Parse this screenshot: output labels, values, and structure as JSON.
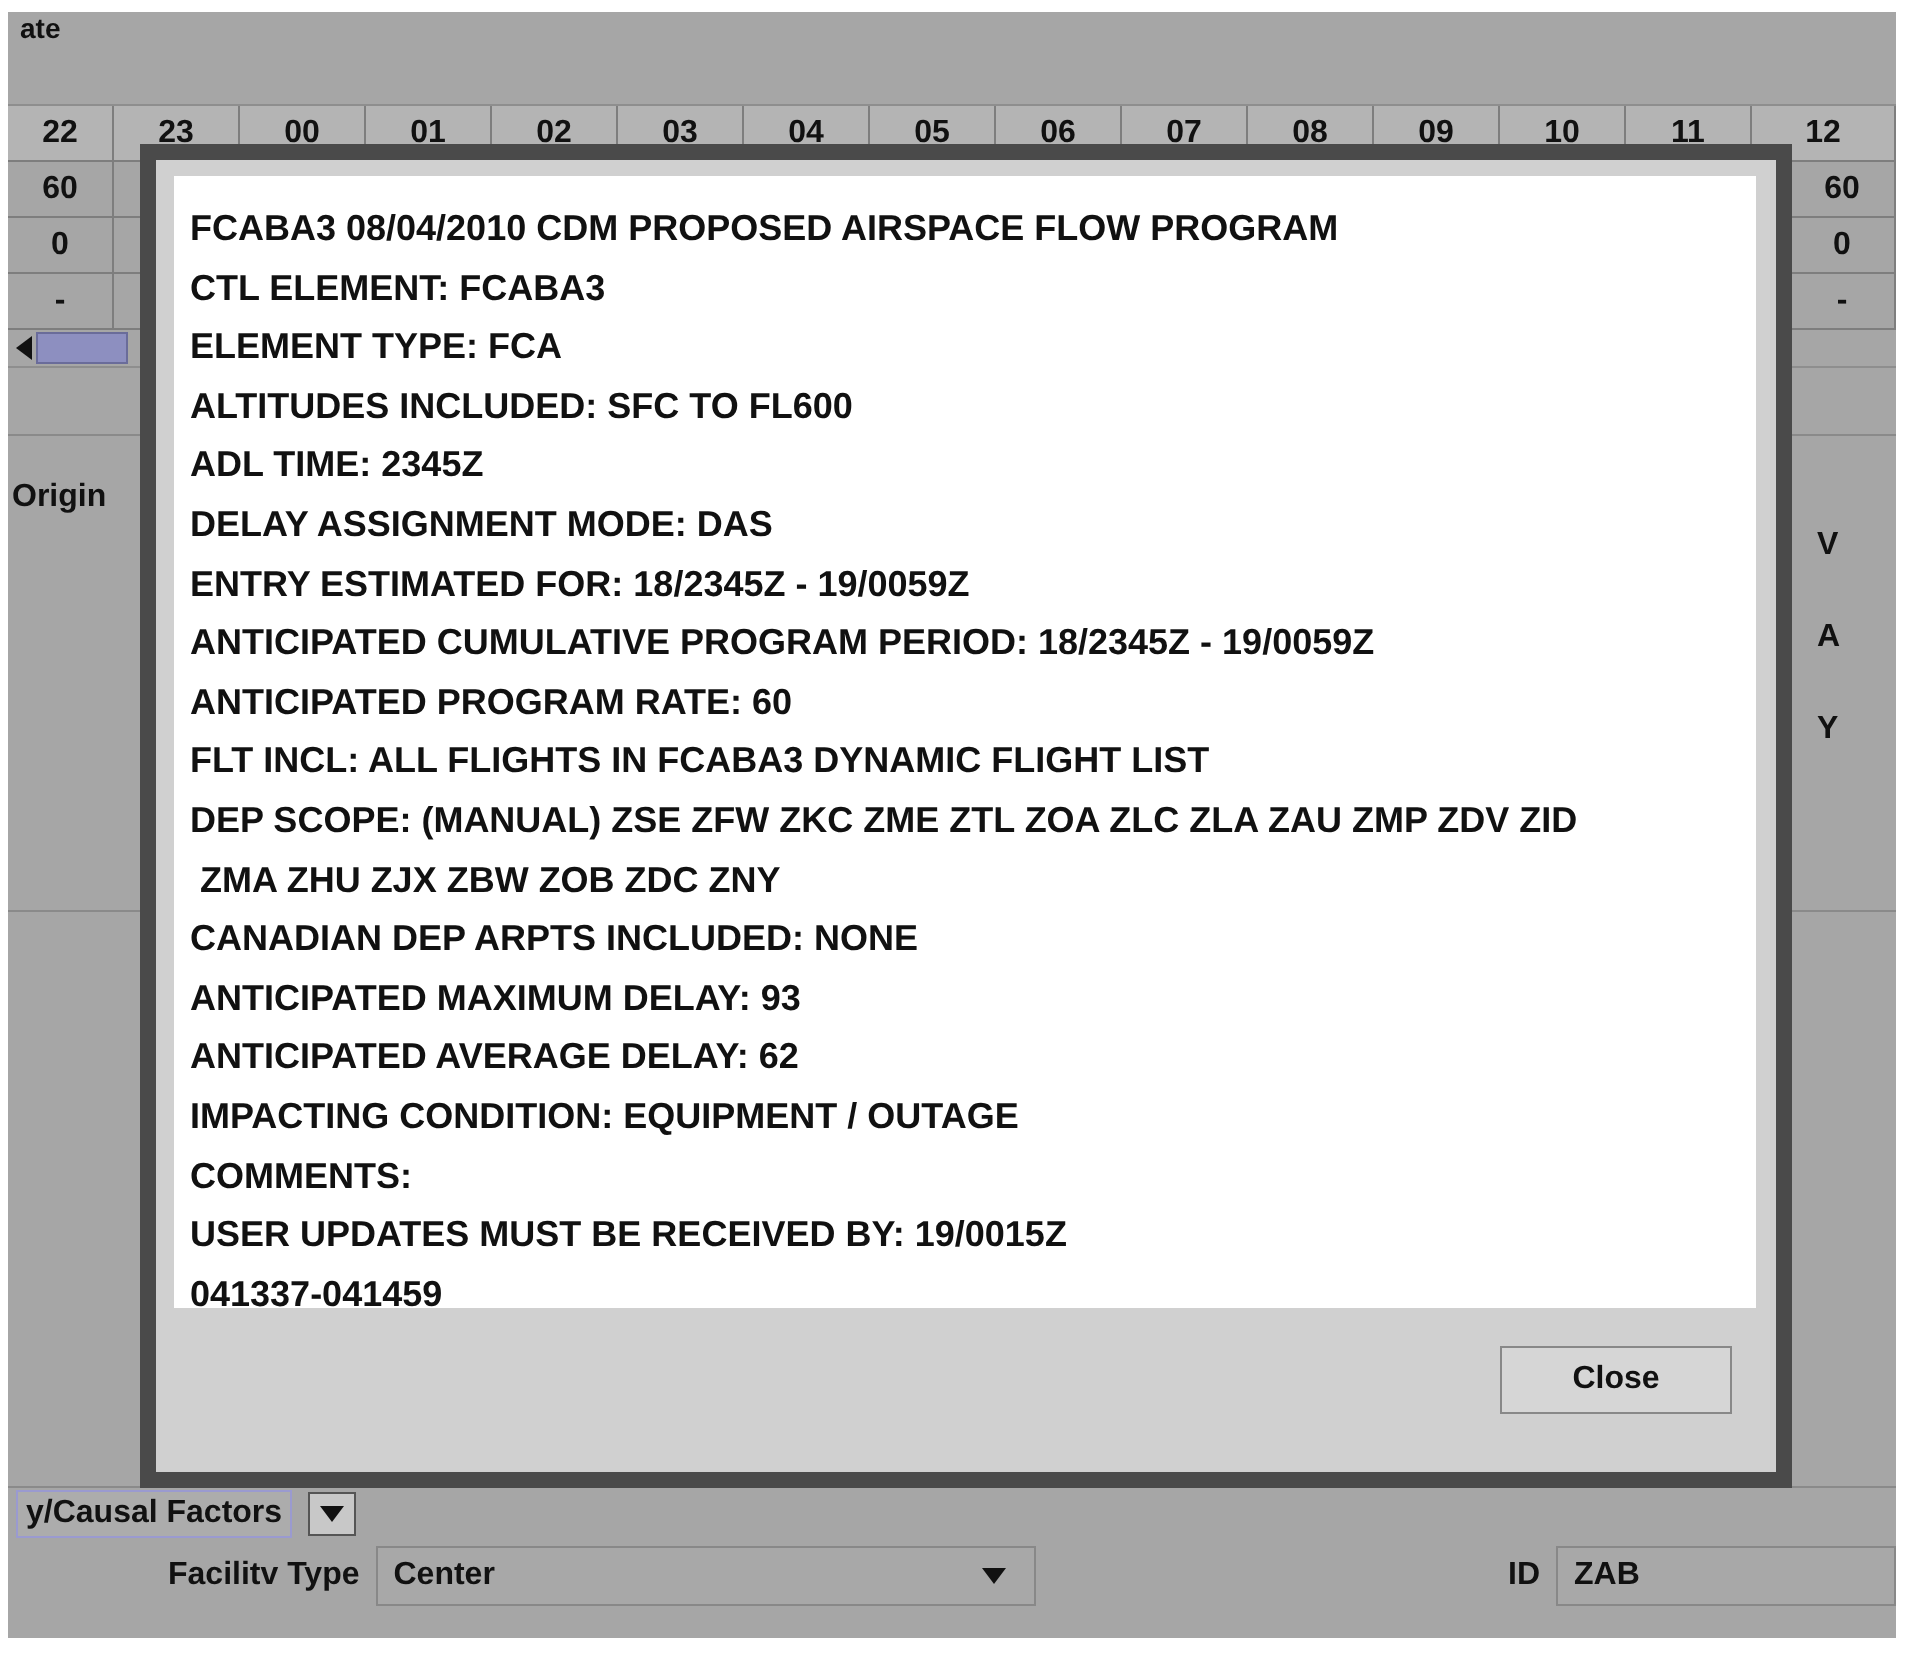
{
  "top_label": "ate",
  "hours": [
    "22",
    "23",
    "00",
    "01",
    "02",
    "03",
    "04",
    "05",
    "06",
    "07",
    "08",
    "09",
    "10",
    "11",
    "12"
  ],
  "rows": [
    {
      "cells": [
        "60",
        "60"
      ]
    },
    {
      "cells": [
        "0",
        "0"
      ]
    },
    {
      "cells": [
        "-",
        "-"
      ]
    }
  ],
  "origin_label": "Origin",
  "right_fragments": [
    "V",
    "A",
    "Y"
  ],
  "dialog": {
    "lines": [
      "FCABA3 08/04/2010 CDM PROPOSED AIRSPACE FLOW PROGRAM",
      "CTL ELEMENT: FCABA3",
      "ELEMENT TYPE: FCA",
      "ALTITUDES INCLUDED: SFC TO FL600",
      "ADL TIME: 2345Z",
      "DELAY ASSIGNMENT MODE: DAS",
      "ENTRY ESTIMATED FOR: 18/2345Z - 19/0059Z",
      "ANTICIPATED CUMULATIVE PROGRAM PERIOD: 18/2345Z - 19/0059Z",
      "ANTICIPATED PROGRAM RATE: 60",
      "FLT INCL: ALL FLIGHTS IN FCABA3 DYNAMIC FLIGHT LIST",
      "DEP SCOPE: (MANUAL) ZSE ZFW ZKC ZME ZTL ZOA ZLC ZLA ZAU ZMP ZDV ZID",
      " ZMA ZHU ZJX ZBW ZOB ZDC ZNY",
      "CANADIAN DEP ARPTS INCLUDED: NONE",
      "ANTICIPATED MAXIMUM DELAY: 93",
      "ANTICIPATED AVERAGE DELAY: 62",
      "IMPACTING CONDITION: EQUIPMENT / OUTAGE",
      "COMMENTS:",
      "USER UPDATES MUST BE RECEIVED BY: 19/0015Z",
      "041337-041459"
    ],
    "close_button": "Close"
  },
  "causal_select": {
    "value": "y/Causal Factors"
  },
  "facility_type": {
    "label": "Facilitv Type",
    "value": "Center"
  },
  "id_field": {
    "label": "ID",
    "value": "ZAB"
  }
}
